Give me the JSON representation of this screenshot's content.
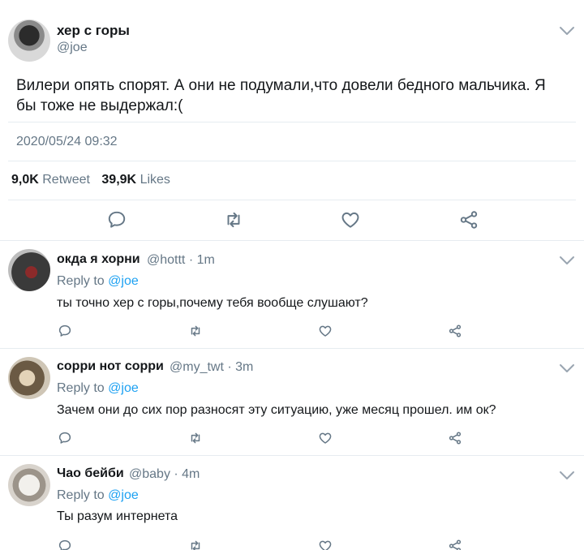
{
  "main_tweet": {
    "display_name": "хер с горы",
    "handle": "@joe",
    "text": "Вилери опять спорят. А они не подумали,что довели бедного мальчика. Я бы тоже не выдержал:(",
    "timestamp": "2020/05/24 09:32",
    "retweet_count": "9,0K",
    "retweet_label": "Retweet",
    "like_count": "39,9K",
    "like_label": "Likes"
  },
  "replies": [
    {
      "display_name": "окда я хорни",
      "meta": "@hottt · 1m",
      "replying_prefix": "Reply to",
      "replying_mention": "@joe",
      "text": "ты точно хер с горы,почему тебя вообще слушают?"
    },
    {
      "display_name": "сорри нот сорри",
      "meta": "@my_twt · 3m",
      "replying_prefix": "Reply to",
      "replying_mention": "@joe",
      "text": "Зачем они до сих пор разносят эту ситуацию, уже месяц прошел. им ок?"
    },
    {
      "display_name": "Чао бейби",
      "meta": "@baby · 4m",
      "replying_prefix": "Reply to",
      "replying_mention": "@joe",
      "text": "Ты разум интернета"
    }
  ],
  "icons": {
    "reply": "comment-icon",
    "retweet": "retweet-icon",
    "like": "heart-icon",
    "share": "share-icon",
    "more": "chevron-down-icon"
  },
  "colors": {
    "text": "#14171a",
    "secondary": "#657786",
    "mention": "#1da1f2",
    "divider": "#e6ecf0"
  }
}
